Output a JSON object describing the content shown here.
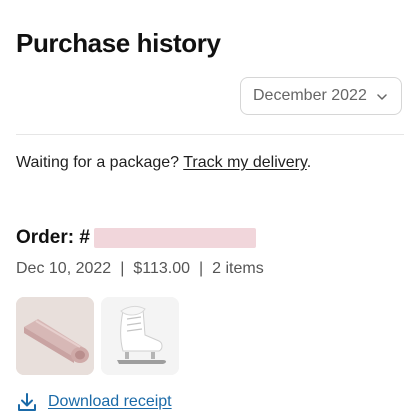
{
  "header": {
    "title": "Purchase history"
  },
  "month_filter": {
    "selected": "December 2022",
    "icon": "chevron-down-icon"
  },
  "notice": {
    "text": "Waiting for a package? ",
    "link_label": "Track my delivery",
    "suffix": "."
  },
  "order": {
    "label": "Order: #",
    "date": "Dec 10, 2022",
    "separator": "|",
    "total": "$113.00",
    "item_count": "2 items",
    "items": [
      {
        "name": "pink-yoga-mat",
        "color": "#d9bfbf"
      },
      {
        "name": "white-ice-skate",
        "color": "#ffffff"
      }
    ],
    "redaction_color": "#f1d6db"
  },
  "receipt": {
    "label": "Download receipt",
    "icon": "download-icon",
    "color": "#1a6aa8"
  }
}
